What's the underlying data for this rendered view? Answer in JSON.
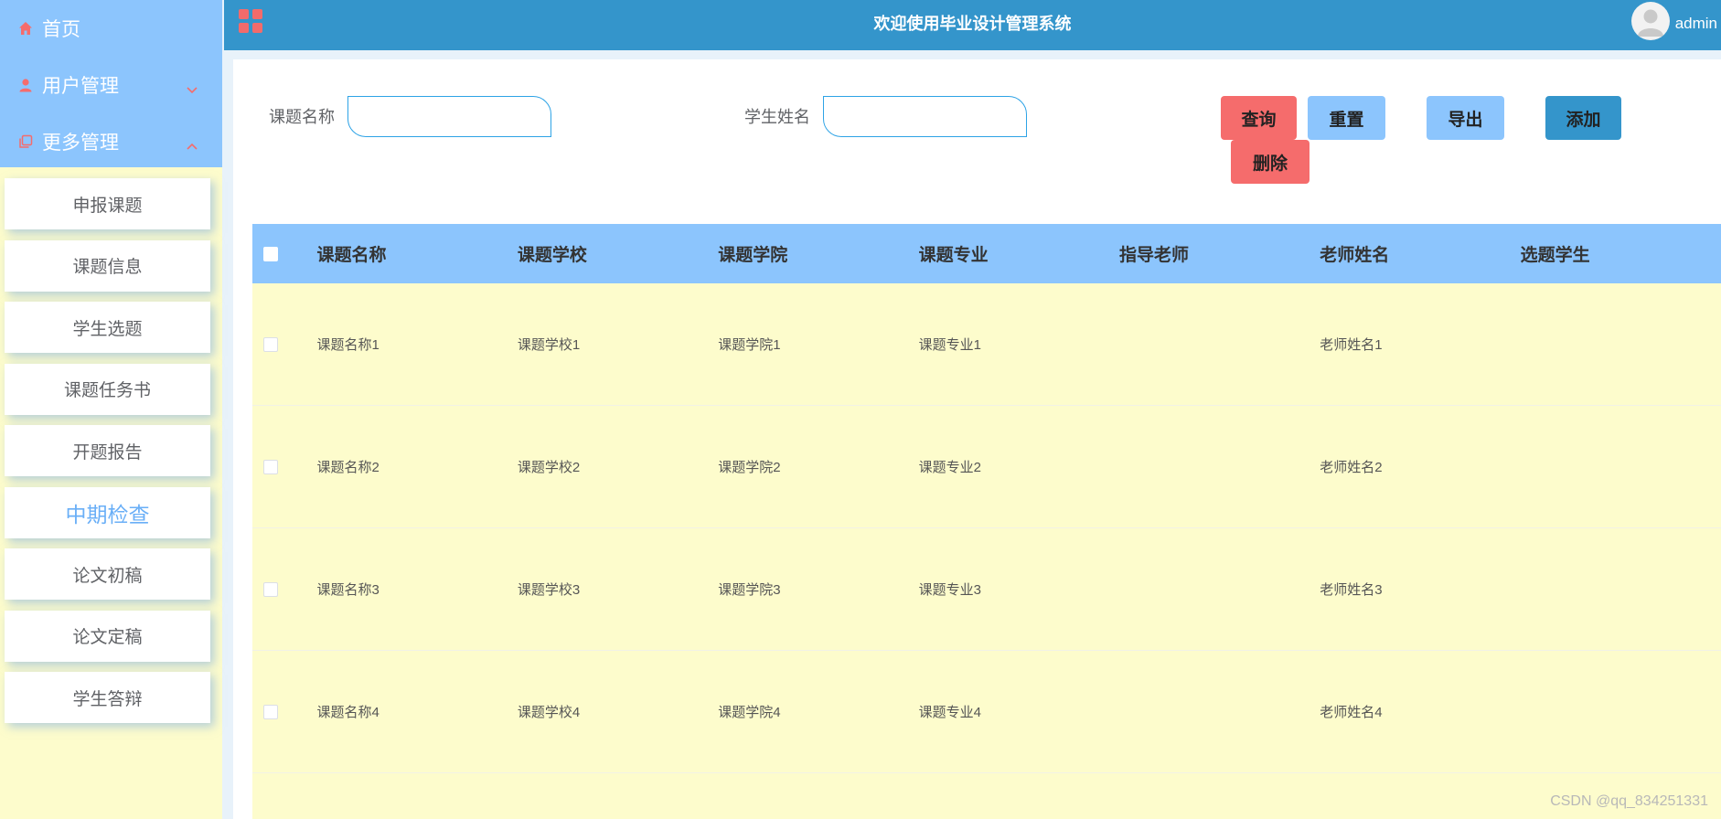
{
  "sidebar": {
    "menu": [
      {
        "label": "首页",
        "icon": "home-icon"
      },
      {
        "label": "用户管理",
        "icon": "user-icon",
        "chevron": "chevron-down-icon"
      },
      {
        "label": "更多管理",
        "icon": "copy-icon",
        "chevron": "chevron-up-icon"
      }
    ],
    "submenu": [
      "申报课题",
      "课题信息",
      "学生选题",
      "课题任务书",
      "开题报告",
      "中期检查",
      "论文初稿",
      "论文定稿",
      "学生答辩"
    ],
    "active_item": "中期检查"
  },
  "topbar": {
    "title": "欢迎使用毕业设计管理系统",
    "username": "admin"
  },
  "search": {
    "topic_label": "课题名称",
    "topic_value": "",
    "student_label": "学生姓名",
    "student_value": ""
  },
  "buttons": {
    "query": "查询",
    "reset": "重置",
    "export": "导出",
    "add": "添加",
    "delete": "删除"
  },
  "table": {
    "headers": [
      "课题名称",
      "课题学校",
      "课题学院",
      "课题专业",
      "指导老师",
      "老师姓名",
      "选题学生"
    ],
    "rows": [
      [
        "课题名称1",
        "课题学校1",
        "课题学院1",
        "课题专业1",
        "",
        "老师姓名1",
        ""
      ],
      [
        "课题名称2",
        "课题学校2",
        "课题学院2",
        "课题专业2",
        "",
        "老师姓名2",
        ""
      ],
      [
        "课题名称3",
        "课题学校3",
        "课题学院3",
        "课题专业3",
        "",
        "老师姓名3",
        ""
      ],
      [
        "课题名称4",
        "课题学校4",
        "课题学院4",
        "课题专业4",
        "",
        "老师姓名4",
        ""
      ]
    ]
  },
  "watermark": "CSDN @qq_834251331",
  "colors": {
    "sidebar_menu_bg": "#8cc5fd",
    "sidebar_bg": "#fdfccc",
    "topbar_bg": "#3495cb",
    "query_btn": "#f56c6c",
    "reset_btn": "#8cc5fd",
    "export_btn": "#8cc5fd",
    "add_btn": "#3495cb",
    "delete_btn": "#f56c6c",
    "table_header": "#8cc5fd",
    "table_row": "#fdfccc",
    "active_text": "#6aaff7"
  }
}
